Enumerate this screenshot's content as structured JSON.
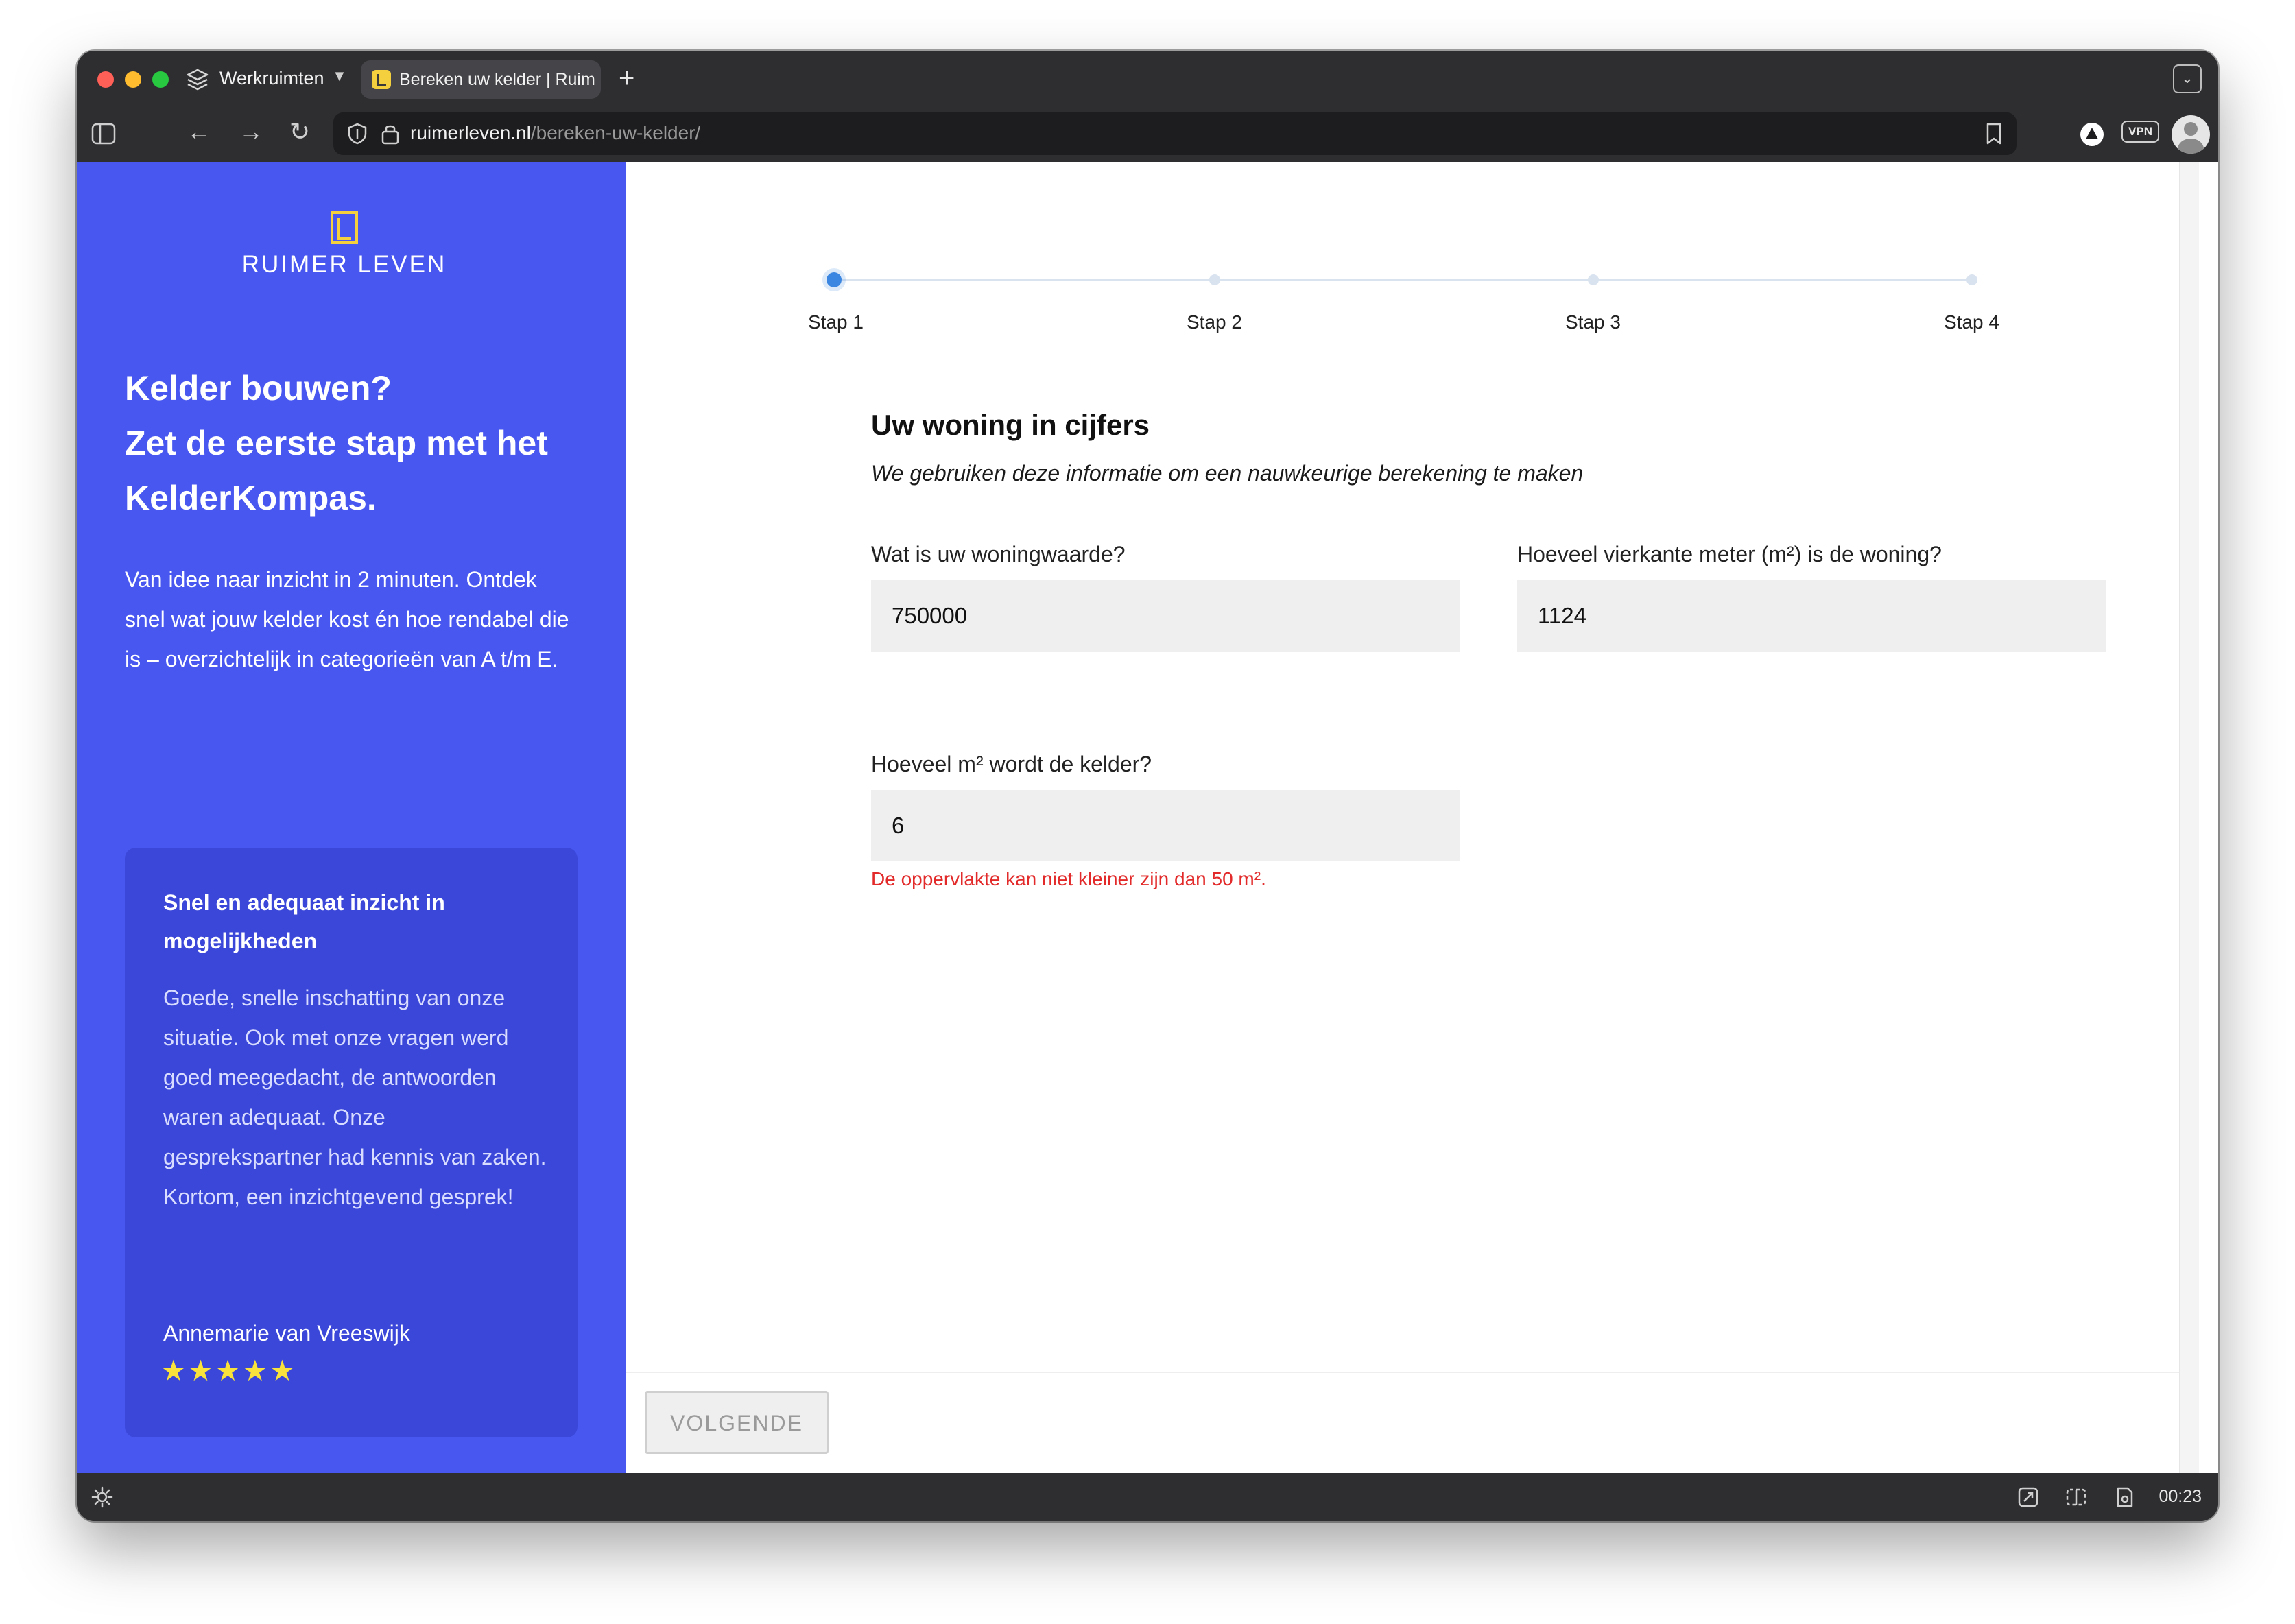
{
  "browser": {
    "workspace_label": "Werkruimten",
    "tab_title": "Bereken uw kelder | Ruimer Leven",
    "url_host": "ruimerleven.nl",
    "url_path": "/bereken-uw-kelder/",
    "vpn_label": "VPN",
    "clock": "00:23"
  },
  "sidebar": {
    "logo_text": "RUIMER LEVEN",
    "hero_lines": [
      "Kelder bouwen?",
      "Zet de eerste stap met het",
      "KelderKompas."
    ],
    "subtitle": "Van idee naar inzicht in 2 minuten. Ontdek snel wat jouw kelder kost én hoe rendabel die is – overzichtelijk in categorieën van A t/m E.",
    "review": {
      "title": "Snel en adequaat inzicht in mogelijkheden",
      "body": "Goede, snelle inschatting van onze situatie. Ook met onze vragen werd goed meegedacht, de antwoorden waren adequaat. Onze gesprekspartner had kennis van zaken. Kortom, een inzichtgevend gesprek!",
      "author": "Annemarie van Vreeswijk",
      "stars": "★★★★★",
      "rating": 5
    }
  },
  "steps": {
    "current": 1,
    "labels": [
      "Stap 1",
      "Stap 2",
      "Stap 3",
      "Stap 4"
    ]
  },
  "form": {
    "title": "Uw woning in cijfers",
    "subtitle": "We gebruiken deze informatie om een nauwkeurige berekening te maken",
    "home_value": {
      "label": "Wat is uw woningwaarde?",
      "value": "750000"
    },
    "home_area": {
      "label": "Hoeveel vierkante meter (m²) is de woning?",
      "value": "1124"
    },
    "basement_area": {
      "label": "Hoeveel m² wordt de kelder?",
      "value": "6"
    },
    "error": "De oppervlakte kan niet kleiner zijn dan 50 m²."
  },
  "footer": {
    "next_label": "VOLGENDE"
  },
  "colors": {
    "sidebar": "#4757ef",
    "card": "#3b47d8",
    "accent": "#f4d03f",
    "error": "#e22a2a",
    "step_active": "#3b86e0"
  }
}
